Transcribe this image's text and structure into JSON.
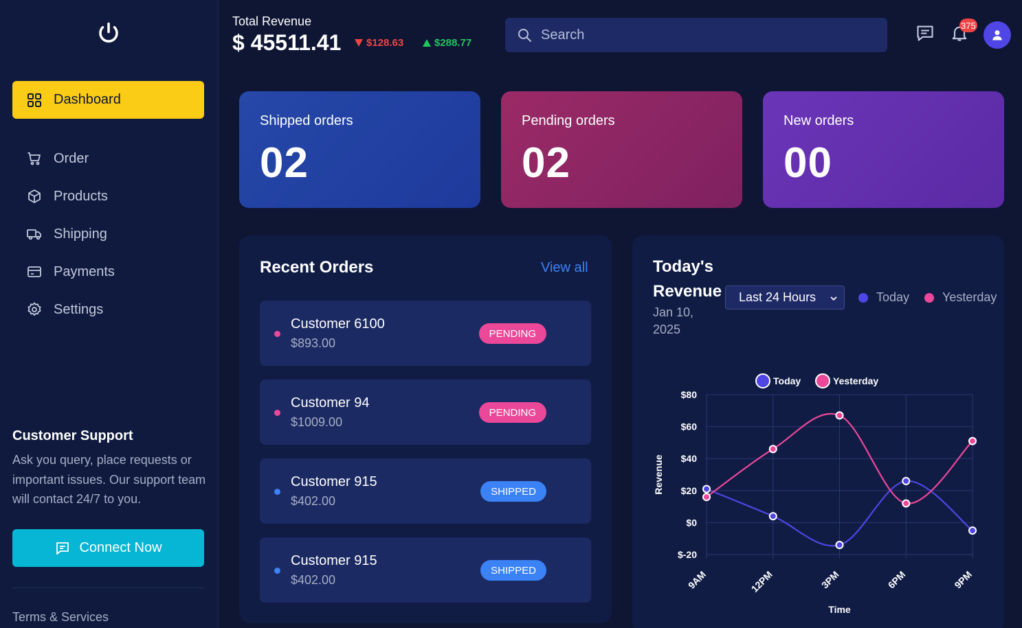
{
  "sidebar": {
    "logo_icon": "power-icon",
    "nav": [
      {
        "label": "Dashboard",
        "icon": "grid-icon",
        "active": true
      },
      {
        "label": "Order",
        "icon": "cart-icon"
      },
      {
        "label": "Products",
        "icon": "box-icon"
      },
      {
        "label": "Shipping",
        "icon": "truck-icon"
      },
      {
        "label": "Payments",
        "icon": "card-icon"
      },
      {
        "label": "Settings",
        "icon": "gear-icon"
      }
    ],
    "support": {
      "title": "Customer Support",
      "text": "Ask you query, place requests or important issues. Our support team will contact 24/7 to you.",
      "button": "Connect Now"
    },
    "terms": "Terms & Services"
  },
  "header": {
    "revenue_label": "Total Revenue",
    "revenue_value": "$ 45511.41",
    "change_down": "$128.63",
    "change_up": "$288.77",
    "search_placeholder": "Search",
    "notification_count": "375"
  },
  "stats": [
    {
      "label": "Shipped orders",
      "value": "02"
    },
    {
      "label": "Pending orders",
      "value": "02"
    },
    {
      "label": "New orders",
      "value": "00"
    }
  ],
  "recent_orders": {
    "title": "Recent Orders",
    "view_all": "View all",
    "items": [
      {
        "name": "Customer 6100",
        "amount": "$893.00",
        "status": "PENDING"
      },
      {
        "name": "Customer 94",
        "amount": "$1009.00",
        "status": "PENDING"
      },
      {
        "name": "Customer 915",
        "amount": "$402.00",
        "status": "SHIPPED"
      },
      {
        "name": "Customer 915",
        "amount": "$402.00",
        "status": "SHIPPED"
      }
    ]
  },
  "revenue": {
    "title": "Today's Revenue",
    "date": "Jan 10, 2025",
    "range_selected": "Last 24 Hours",
    "legend": [
      "Today",
      "Yesterday"
    ]
  },
  "colors": {
    "accent": "#facc15",
    "today": "#4f46e5",
    "yesterday": "#ec4899",
    "pending": "#ec4899",
    "shipped": "#3b82f6"
  },
  "chart_data": {
    "type": "line",
    "categories": [
      "9AM",
      "12PM",
      "3PM",
      "6PM",
      "9PM"
    ],
    "series": [
      {
        "name": "Today",
        "values": [
          21,
          4,
          -14,
          26,
          -5
        ]
      },
      {
        "name": "Yesterday",
        "values": [
          16,
          46,
          67,
          12,
          51
        ]
      }
    ],
    "xlabel": "Time",
    "ylabel": "Revenue",
    "ylim": [
      -20,
      80
    ],
    "yticks": [
      "$-20",
      "$0",
      "$20",
      "$40",
      "$60",
      "$80"
    ],
    "legend_position": "top",
    "grid": true
  }
}
